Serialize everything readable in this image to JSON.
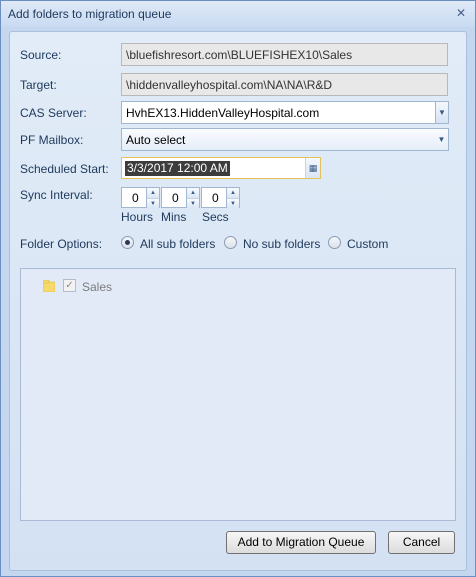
{
  "window": {
    "title": "Add folders to migration queue",
    "close_glyph": "✕"
  },
  "form": {
    "source_label": "Source:",
    "source_value": "\\bluefishresort.com\\BLUEFISHEX10\\Sales",
    "target_label": "Target:",
    "target_value": "\\hiddenvalleyhospital.com\\NA\\NA\\R&D",
    "cas_label": "CAS Server:",
    "cas_value": "HvhEX13.HiddenValleyHospital.com",
    "pf_label": "PF Mailbox:",
    "pf_value": "Auto select",
    "start_label": "Scheduled Start:",
    "start_value": "3/3/2017 12:00 AM",
    "sync_label": "Sync Interval:",
    "hours_value": "0",
    "mins_value": "0",
    "secs_value": "0",
    "hours_label": "Hours",
    "mins_label": "Mins",
    "secs_label": "Secs",
    "options_label": "Folder Options:",
    "options": [
      "All sub folders",
      "No sub folders",
      "Custom"
    ],
    "selected_option": "All sub folders"
  },
  "tree": {
    "items": [
      {
        "label": "Sales",
        "checked": true
      }
    ]
  },
  "buttons": {
    "add": "Add to Migration Queue",
    "cancel": "Cancel"
  },
  "icons": {
    "dropdown": "chevron-down-icon",
    "calendar": "calendar-icon",
    "folder": "folder-icon"
  },
  "colors": {
    "titlebar": "#c9dbf2",
    "panel": "#d9e6f6",
    "highlight": "#e3c25c"
  }
}
